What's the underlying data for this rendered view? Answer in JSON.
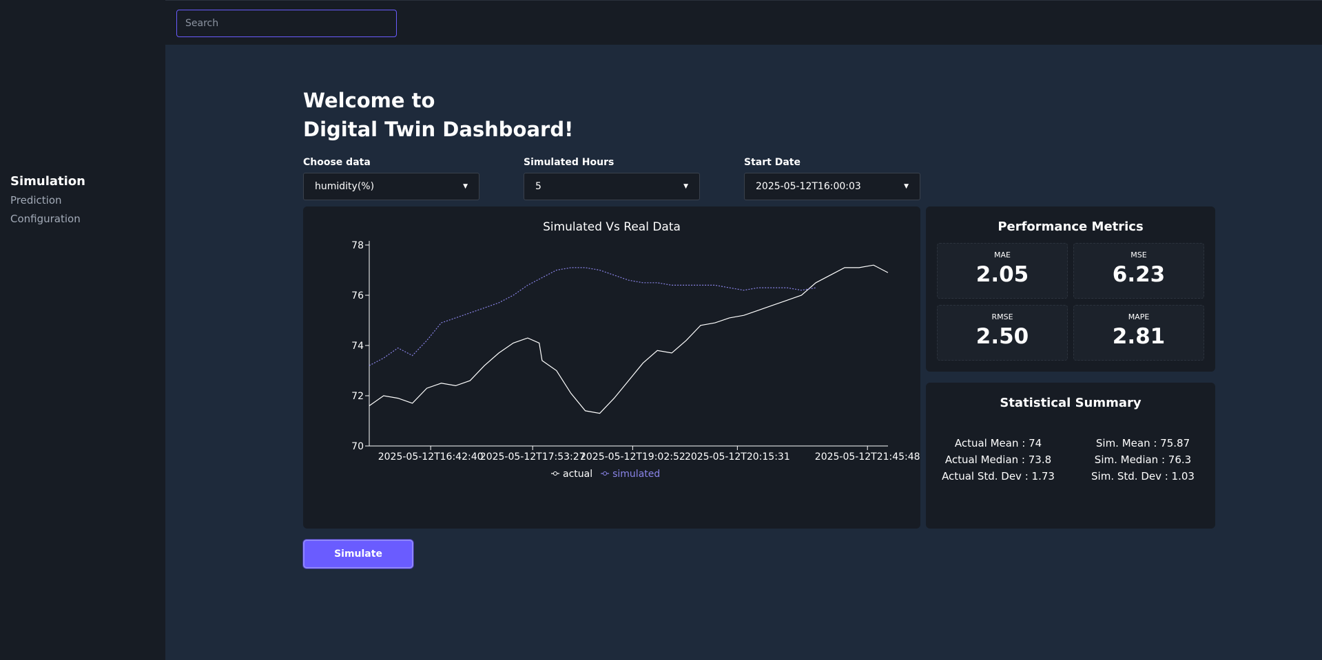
{
  "search": {
    "placeholder": "Search"
  },
  "sidebar": {
    "items": [
      {
        "label": "Simulation",
        "active": true
      },
      {
        "label": "Prediction",
        "active": false
      },
      {
        "label": "Configuration",
        "active": false
      }
    ]
  },
  "header": {
    "line1": "Welcome to",
    "line2": "Digital Twin Dashboard!"
  },
  "controls": {
    "data": {
      "label": "Choose data",
      "value": "humidity(%)"
    },
    "hours": {
      "label": "Simulated Hours",
      "value": "5"
    },
    "start": {
      "label": "Start Date",
      "value": "2025-05-12T16:00:03"
    }
  },
  "colors": {
    "accent": "#6a5cff",
    "actual": "#ffffff",
    "simulated": "#8a84e8"
  },
  "metrics": {
    "title": "Performance Metrics",
    "mae": {
      "label": "MAE",
      "value": "2.05"
    },
    "mse": {
      "label": "MSE",
      "value": "6.23"
    },
    "rmse": {
      "label": "RMSE",
      "value": "2.50"
    },
    "mape": {
      "label": "MAPE",
      "value": "2.81"
    }
  },
  "stats": {
    "title": "Statistical Summary",
    "actual_mean": "Actual Mean : 74",
    "actual_median": "Actual Median : 73.8",
    "actual_std": "Actual Std. Dev : 1.73",
    "sim_mean": "Sim. Mean : 75.87",
    "sim_median": "Sim. Median : 76.3",
    "sim_std": "Sim. Std. Dev : 1.03"
  },
  "simulate_label": "Simulate",
  "chart_data": {
    "type": "line",
    "title": "Simulated Vs Real Data",
    "xlabel": "",
    "ylabel": "",
    "ylim": [
      70,
      78
    ],
    "xlim": [
      "2025-05-12T16:00:03",
      "2025-05-12T22:00:03"
    ],
    "y_ticks": [
      70,
      72,
      74,
      76,
      78
    ],
    "x_ticks": [
      "2025-05-12T16:42:40",
      "2025-05-12T17:53:27",
      "2025-05-12T19:02:52",
      "2025-05-12T20:15:31",
      "2025-05-12T21:45:48"
    ],
    "legend": "bottom",
    "grid": false,
    "series": [
      {
        "name": "actual",
        "points": [
          [
            "2025-05-12T16:00:03",
            71.6
          ],
          [
            "2025-05-12T16:10:00",
            72.0
          ],
          [
            "2025-05-12T16:20:00",
            71.9
          ],
          [
            "2025-05-12T16:30:00",
            71.7
          ],
          [
            "2025-05-12T16:40:00",
            72.3
          ],
          [
            "2025-05-12T16:50:00",
            72.5
          ],
          [
            "2025-05-12T17:00:00",
            72.4
          ],
          [
            "2025-05-12T17:10:00",
            72.6
          ],
          [
            "2025-05-12T17:20:00",
            73.2
          ],
          [
            "2025-05-12T17:30:00",
            73.7
          ],
          [
            "2025-05-12T17:40:00",
            74.1
          ],
          [
            "2025-05-12T17:50:00",
            74.3
          ],
          [
            "2025-05-12T17:58:00",
            74.1
          ],
          [
            "2025-05-12T18:00:00",
            73.4
          ],
          [
            "2025-05-12T18:10:00",
            73.0
          ],
          [
            "2025-05-12T18:20:00",
            72.1
          ],
          [
            "2025-05-12T18:30:00",
            71.4
          ],
          [
            "2025-05-12T18:40:00",
            71.3
          ],
          [
            "2025-05-12T18:50:00",
            71.9
          ],
          [
            "2025-05-12T19:00:00",
            72.6
          ],
          [
            "2025-05-12T19:10:00",
            73.3
          ],
          [
            "2025-05-12T19:20:00",
            73.8
          ],
          [
            "2025-05-12T19:30:00",
            73.7
          ],
          [
            "2025-05-12T19:40:00",
            74.2
          ],
          [
            "2025-05-12T19:50:00",
            74.8
          ],
          [
            "2025-05-12T20:00:00",
            74.9
          ],
          [
            "2025-05-12T20:10:00",
            75.1
          ],
          [
            "2025-05-12T20:20:00",
            75.2
          ],
          [
            "2025-05-12T20:30:00",
            75.4
          ],
          [
            "2025-05-12T20:40:00",
            75.6
          ],
          [
            "2025-05-12T20:50:00",
            75.8
          ],
          [
            "2025-05-12T21:00:00",
            76.0
          ],
          [
            "2025-05-12T21:10:00",
            76.5
          ],
          [
            "2025-05-12T21:20:00",
            76.8
          ],
          [
            "2025-05-12T21:30:00",
            77.1
          ],
          [
            "2025-05-12T21:40:00",
            77.1
          ],
          [
            "2025-05-12T21:50:00",
            77.2
          ],
          [
            "2025-05-12T22:00:00",
            76.9
          ]
        ]
      },
      {
        "name": "simulated",
        "points": [
          [
            "2025-05-12T16:00:03",
            73.2
          ],
          [
            "2025-05-12T16:10:00",
            73.5
          ],
          [
            "2025-05-12T16:20:00",
            73.9
          ],
          [
            "2025-05-12T16:30:00",
            73.6
          ],
          [
            "2025-05-12T16:40:00",
            74.2
          ],
          [
            "2025-05-12T16:50:00",
            74.9
          ],
          [
            "2025-05-12T17:00:00",
            75.1
          ],
          [
            "2025-05-12T17:10:00",
            75.3
          ],
          [
            "2025-05-12T17:20:00",
            75.5
          ],
          [
            "2025-05-12T17:30:00",
            75.7
          ],
          [
            "2025-05-12T17:40:00",
            76.0
          ],
          [
            "2025-05-12T17:50:00",
            76.4
          ],
          [
            "2025-05-12T18:00:00",
            76.7
          ],
          [
            "2025-05-12T18:10:00",
            77.0
          ],
          [
            "2025-05-12T18:20:00",
            77.1
          ],
          [
            "2025-05-12T18:30:00",
            77.1
          ],
          [
            "2025-05-12T18:40:00",
            77.0
          ],
          [
            "2025-05-12T18:50:00",
            76.8
          ],
          [
            "2025-05-12T19:00:00",
            76.6
          ],
          [
            "2025-05-12T19:10:00",
            76.5
          ],
          [
            "2025-05-12T19:20:00",
            76.5
          ],
          [
            "2025-05-12T19:30:00",
            76.4
          ],
          [
            "2025-05-12T19:40:00",
            76.4
          ],
          [
            "2025-05-12T19:50:00",
            76.4
          ],
          [
            "2025-05-12T20:00:00",
            76.4
          ],
          [
            "2025-05-12T20:10:00",
            76.3
          ],
          [
            "2025-05-12T20:20:00",
            76.2
          ],
          [
            "2025-05-12T20:30:00",
            76.3
          ],
          [
            "2025-05-12T20:40:00",
            76.3
          ],
          [
            "2025-05-12T20:50:00",
            76.3
          ],
          [
            "2025-05-12T21:00:00",
            76.2
          ],
          [
            "2025-05-12T21:10:00",
            76.3
          ]
        ]
      }
    ]
  }
}
